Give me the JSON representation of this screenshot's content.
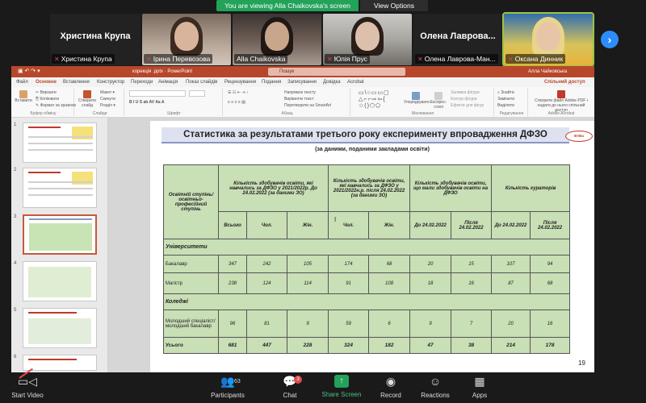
{
  "banner": {
    "viewing_text": "You are viewing Alla Chaikovska's screen",
    "view_options": "View Options"
  },
  "participants": [
    {
      "big": "Христина Крупа",
      "label": "Христина Крупа"
    },
    {
      "big": "",
      "label": "Ірина Перевозова"
    },
    {
      "big": "",
      "label": "Alla Chaikovska"
    },
    {
      "big": "",
      "label": "Юлія Прус"
    },
    {
      "big": "Олена Лаврова...",
      "label": "Олена Лаврова-Ман..."
    },
    {
      "big": "",
      "label": "Оксана Динник"
    }
  ],
  "ppt": {
    "doc_title": "корекція .pptx  ·  PowerPoint",
    "search": "Пошук",
    "user": "Алла Чайковська",
    "share": "Спільний доступ",
    "tabs": [
      "Файл",
      "Основне",
      "Вставлення",
      "Конструктор",
      "Переходи",
      "Анімація",
      "Показ слайдів",
      "Рецензування",
      "Подання",
      "Записування",
      "Довідка",
      "Acrobat"
    ],
    "ribbon": {
      "paste": "Вставити",
      "cut": "Вирізати",
      "copy": "Копіювати",
      "format": "Формат за зразком",
      "clipboard": "Буфер обміну",
      "new_slide": "Створити слайд",
      "layout": "Макет",
      "reset": "Скинути",
      "section": "Розділ",
      "slides": "Слайди",
      "font": "Шрифт",
      "text_dir": "Напрямок тексту",
      "align_text": "Вирівняти текст",
      "smartart": "Перетворити на SmartArt",
      "paragraph": "Абзац",
      "arrange": "Упорядкувати",
      "quick_styles": "Експрес-стилі",
      "shape_fill": "Заливка фігури",
      "shape_outline": "Контур фігури",
      "shape_effects": "Ефекти для фігур",
      "drawing": "Малювання",
      "find": "Знайти",
      "replace": "Замінити",
      "select": "Виділити",
      "editing": "Редагування",
      "acrobat_btn": "Створити файл Adobe PDF і надати до нього спільний доступ",
      "acrobat": "Adobe Acrobat"
    },
    "thumb_numbers": [
      "1",
      "2",
      "3",
      "4",
      "5",
      "6"
    ]
  },
  "slide": {
    "title": "Статистика за результатами третього року експерименту впровадження ДФЗО",
    "subtitle": "(за даними, поданими закладами освіти)",
    "logo": "ВтМа",
    "page_number": "19",
    "headers": {
      "col1": "Освітній ступінь/освітньо-професійний ступінь",
      "col2": "Кількість здобувачів освіти, які навчались за ДФЗО у 2021/2022р. До 24.02.2022 (за даними ЗО)",
      "col3": "Кількість здобувачів освіти, які навчались за ДФЗО у 2021/2022н.р. після 24.02.2022 (за даними ЗО)",
      "col4": "Кількість здобувачів освіти, що мали здобувачів освіти на ДФЗО",
      "col5": "Кількість кураторів",
      "sub": [
        "Всього",
        "Чол.",
        "Жін.",
        "Чол.",
        "Жін.",
        "До 24.02.2022",
        "Після 24.02.2022",
        "До 24.02.2022",
        "Після 24.02.2022"
      ]
    },
    "sections": {
      "universities": "Університети",
      "colleges": "Коледжі"
    },
    "rows": [
      {
        "label": "Бакалавр",
        "values": [
          "347",
          "242",
          "105",
          "174",
          "68",
          "20",
          "15",
          "107",
          "94"
        ]
      },
      {
        "label": "Магістр",
        "values": [
          "238",
          "124",
          "114",
          "91",
          "108",
          "18",
          "16",
          "87",
          "68"
        ]
      },
      {
        "label": "Молодший спеціаліст/молодший бакалавр",
        "values": [
          "96",
          "81",
          "9",
          "59",
          "6",
          "9",
          "7",
          "20",
          "16"
        ]
      }
    ],
    "total": {
      "label": "Усього",
      "values": [
        "681",
        "447",
        "228",
        "324",
        "182",
        "47",
        "38",
        "214",
        "178"
      ]
    }
  },
  "toolbar": {
    "start_video": "Start Video",
    "participants": "Participants",
    "participant_count": "63",
    "chat": "Chat",
    "chat_badge": "3",
    "share_screen": "Share Screen",
    "record": "Record",
    "reactions": "Reactions",
    "apps": "Apps"
  },
  "colors": {
    "ppt_accent": "#b7472a",
    "zoom_green": "#23a25a",
    "table_green": "#c9dfb6",
    "muted_red": "#e0474c"
  }
}
